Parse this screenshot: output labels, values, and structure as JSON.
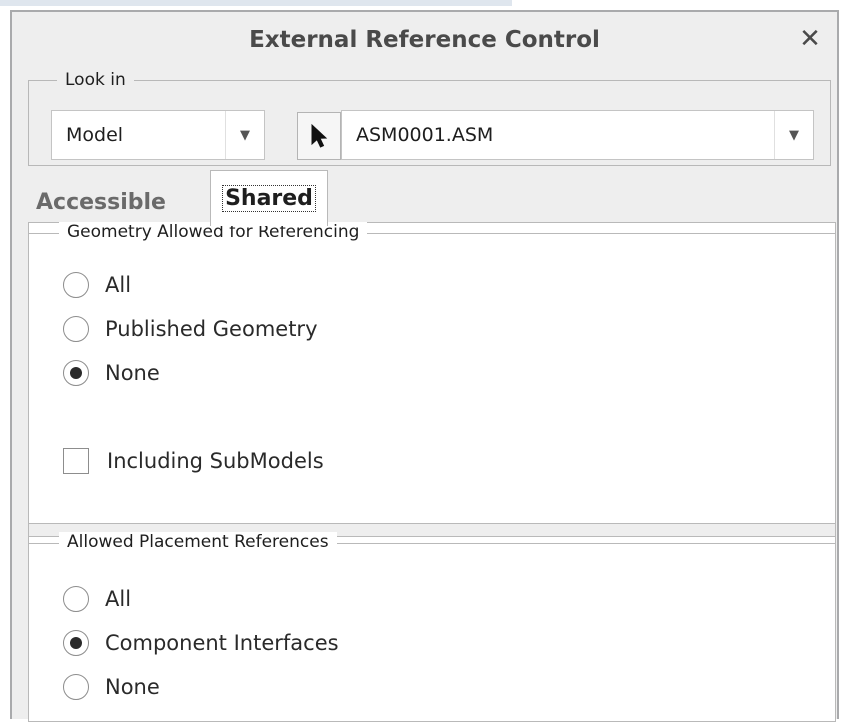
{
  "dialog": {
    "title": "External Reference Control",
    "close_label": "✕"
  },
  "look_in": {
    "legend": "Look in",
    "model_select": {
      "value": "Model",
      "arrow": "▼"
    },
    "pick_icon": "arrow-cursor-icon",
    "assembly_select": {
      "value": "ASM0001.ASM",
      "arrow": "▼"
    }
  },
  "tabs": [
    {
      "label": "Accessible",
      "active": false
    },
    {
      "label": "Shared",
      "active": true
    }
  ],
  "geometry_section": {
    "title": "Geometry Allowed for Referencing",
    "options": [
      {
        "label": "All",
        "selected": false
      },
      {
        "label": "Published Geometry",
        "selected": false
      },
      {
        "label": "None",
        "selected": true
      }
    ],
    "include_submodels": {
      "label": "Including SubModels",
      "checked": false
    }
  },
  "placement_section": {
    "title": "Allowed Placement References",
    "options": [
      {
        "label": "All",
        "selected": false
      },
      {
        "label": "Component Interfaces",
        "selected": true
      },
      {
        "label": "None",
        "selected": false
      }
    ]
  }
}
